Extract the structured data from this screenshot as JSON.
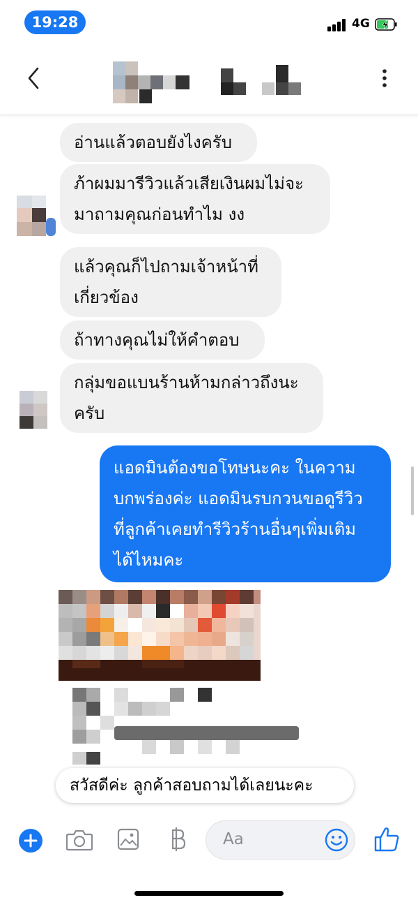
{
  "status": {
    "time": "19:28",
    "network": "4G"
  },
  "messages_in": [
    "อ่านแล้วตอบยังไงครับ",
    "ภ้าผมมารีวิวแล้วเสียเงินผมไม่จะ",
    "มาถามคุณก่อนทำไม งง",
    "แล้วคุณก็ไปถามเจ้าหน้าที่",
    "เกี่ยวข้อง",
    "ถ้าทางคุณไม่ให้คำตอบ",
    "กลุ่มขอแบนร้านห้ามกล่าวถึงนะ",
    "ครับ"
  ],
  "message_out": [
    "แอดมินต้องขอโทษนะคะ ในความ",
    "บกพร่องค่ะ แอดมินรบกวนขอดูรีวิว",
    "ที่ลูกค้าเคยทำรีวิวร้านอื่นๆเพิ่มเติม",
    "ได้ไหมคะ"
  ],
  "quick_reply": "สวัสดีค่ะ ลูกค้าสอบถามได้เลยนะคะ",
  "composer": {
    "placeholder": "Aa"
  },
  "icons": [
    "plus-icon",
    "camera-icon",
    "image-icon",
    "baht-icon",
    "emoji-icon",
    "thumbs-up-icon",
    "back-arrow-icon",
    "more-vertical-icon"
  ],
  "colors": {
    "accent": "#1877f2",
    "incoming_bubble": "#f1f0f0"
  }
}
